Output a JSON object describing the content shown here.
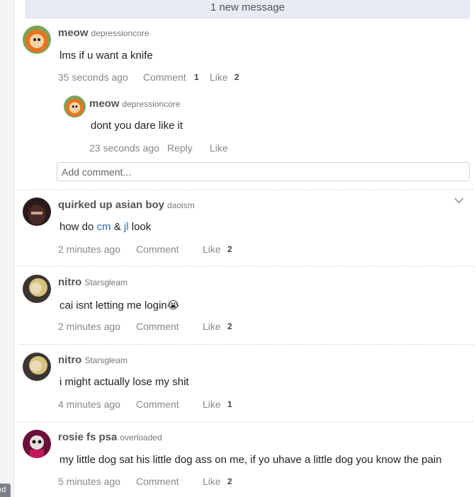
{
  "banner": {
    "text": "1 new message"
  },
  "gutter": {
    "tag": "ed"
  },
  "posts": [
    {
      "user": "meow",
      "handle": "depressioncore",
      "text": "lms if u want a knife",
      "time": "35 seconds ago",
      "comment_label": "Comment",
      "comment_count": "1",
      "like_label": "Like",
      "like_count": "2",
      "reply": {
        "user": "meow",
        "handle": "depressioncore",
        "text": "dont you dare like it",
        "time": "23 seconds ago",
        "reply_label": "Reply",
        "like_label": "Like"
      },
      "add_comment_placeholder": "Add comment..."
    },
    {
      "user": "quirked up asian boy",
      "handle": "daoism",
      "text_before": "how do ",
      "link1": "cm",
      "text_mid": " & ",
      "link2": "jl",
      "text_after": " look",
      "time": "2 minutes ago",
      "comment_label": "Comment",
      "like_label": "Like",
      "like_count": "2"
    },
    {
      "user": "nitro",
      "handle": "Starsgleam",
      "text": "cai isnt letting me login😭",
      "time": "2 minutes ago",
      "comment_label": "Comment",
      "like_label": "Like",
      "like_count": "2"
    },
    {
      "user": "nitro",
      "handle": "Starsgleam",
      "text": "i might actually lose my shit",
      "time": "4 minutes ago",
      "comment_label": "Comment",
      "like_label": "Like",
      "like_count": "1"
    },
    {
      "user": "rosie fs psa",
      "handle": "overloaded",
      "text": "my little dog sat his little dog ass on me, if yo uhave a little dog you know the pain",
      "time": "5 minutes ago",
      "comment_label": "Comment",
      "like_label": "Like",
      "like_count": "2"
    }
  ],
  "icons": {
    "menu": "chevron-down-icon",
    "avatar": "avatar"
  }
}
